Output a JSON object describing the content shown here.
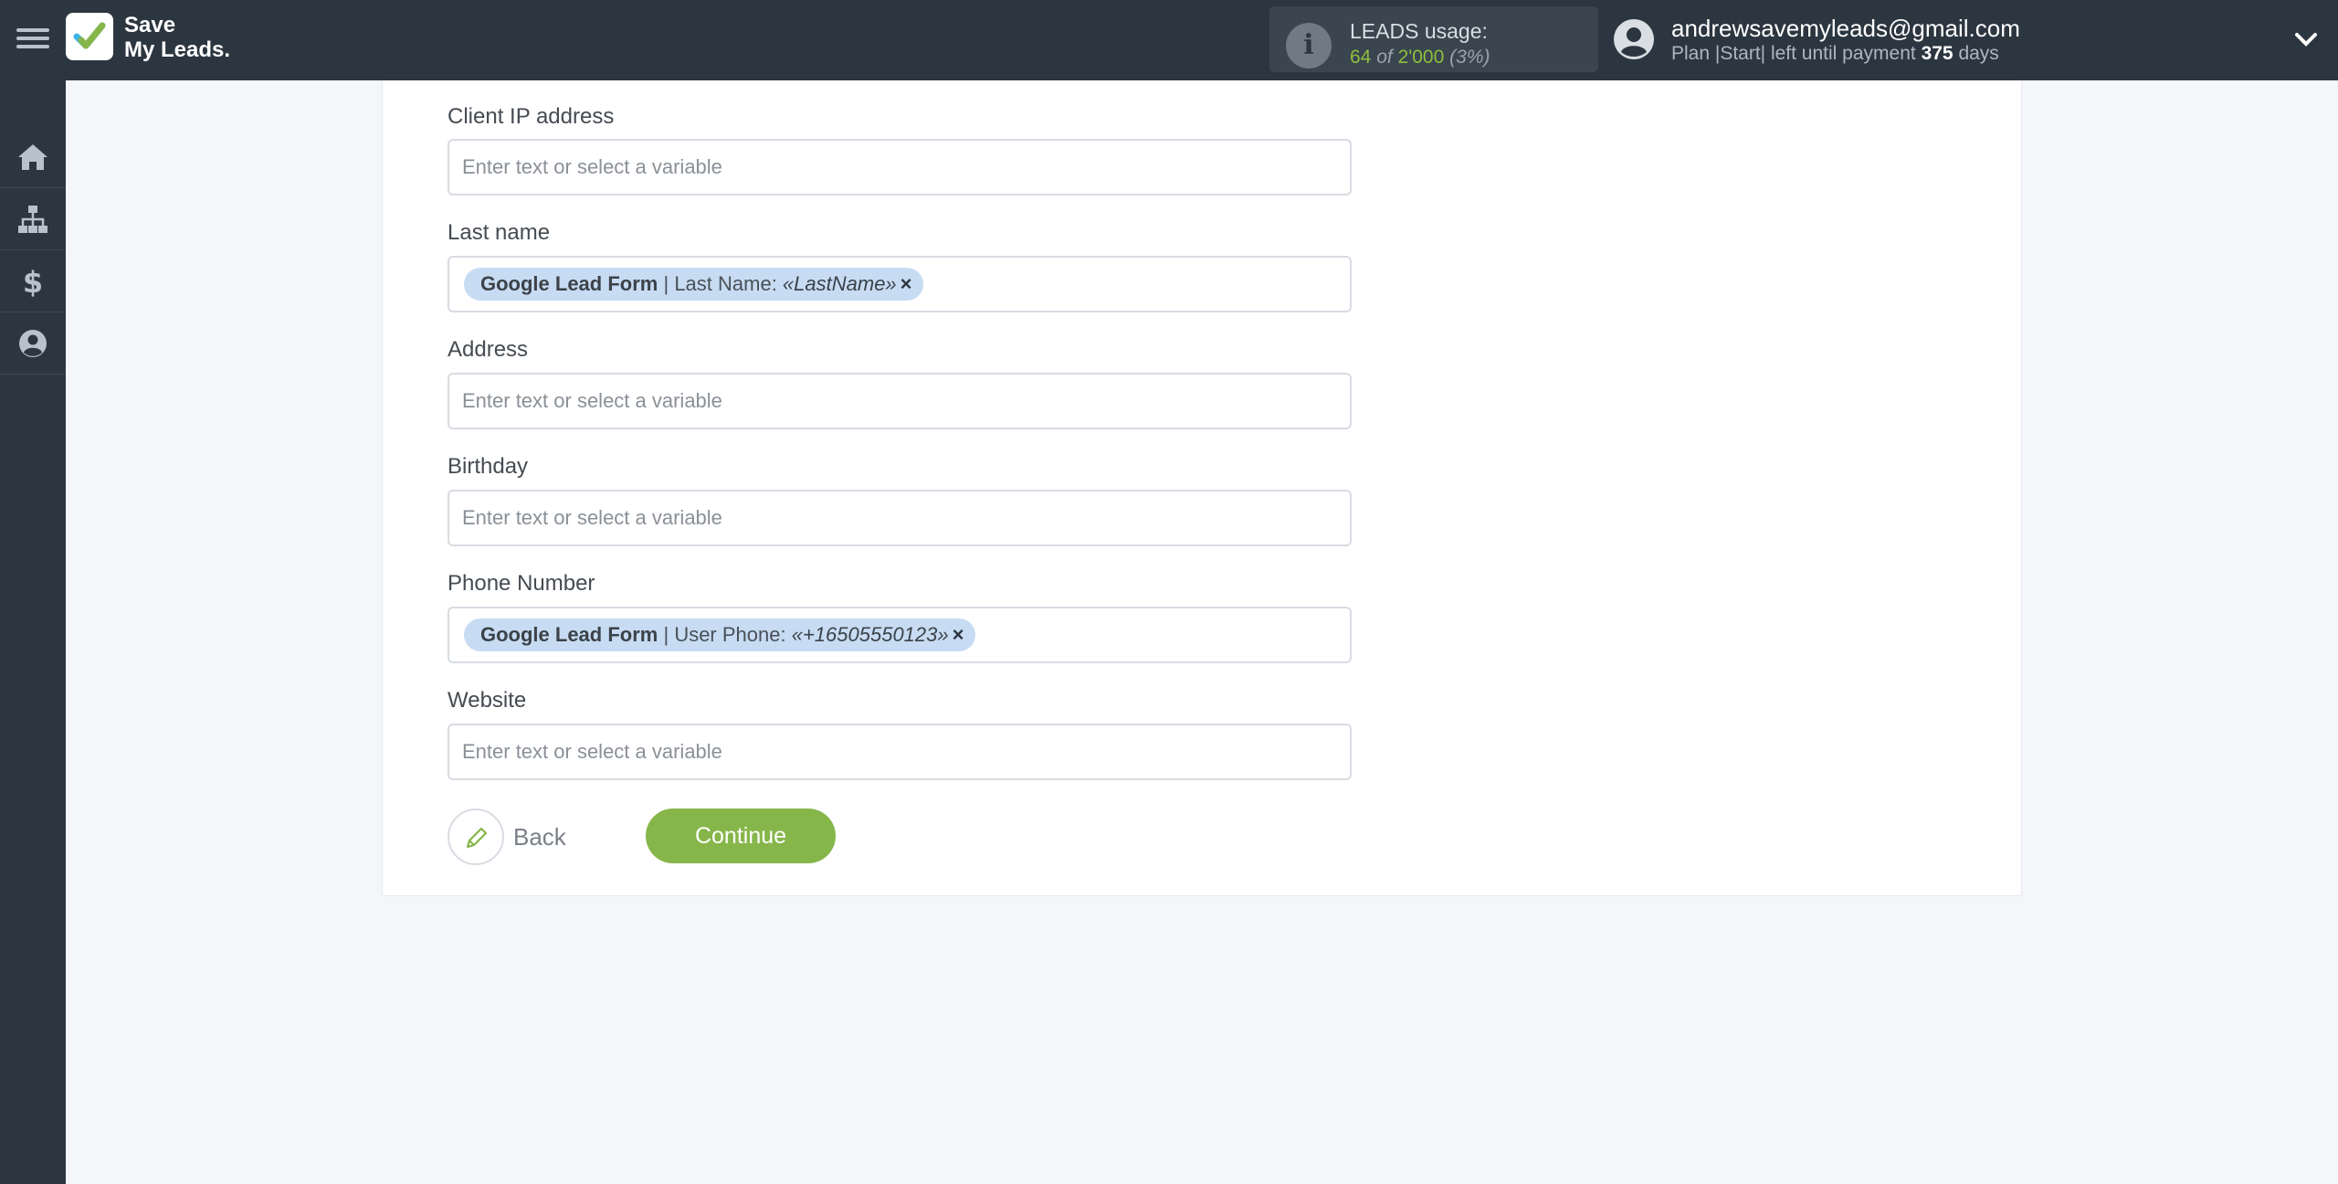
{
  "brand": {
    "line1": "Save",
    "line2": "My Leads."
  },
  "usage": {
    "title": "LEADS usage:",
    "used": "64",
    "of": "of",
    "total": "2'000",
    "percent": "(3%)"
  },
  "account": {
    "email": "andrewsavemyleads@gmail.com",
    "plan_prefix": "Plan |Start| left until payment",
    "days": "375",
    "days_suffix": "days"
  },
  "sidebar": {
    "items": [
      "home-icon",
      "sitemap-icon",
      "dollar-icon",
      "user-icon"
    ]
  },
  "form": {
    "fields": [
      {
        "label": "Client IP address",
        "placeholder": "Enter text or select a variable"
      },
      {
        "label": "Last name",
        "chip": {
          "source": "Google Lead Form",
          "sep": " | ",
          "field": "Last Name: ",
          "value": "«LastName»",
          "remove": "×"
        }
      },
      {
        "label": "Address",
        "placeholder": "Enter text or select a variable"
      },
      {
        "label": "Birthday",
        "placeholder": "Enter text or select a variable"
      },
      {
        "label": "Phone Number",
        "chip": {
          "source": "Google Lead Form",
          "sep": " | ",
          "field": "User Phone: ",
          "value": "«+16505550123»",
          "remove": "×"
        }
      },
      {
        "label": "Website",
        "placeholder": "Enter text or select a variable"
      }
    ]
  },
  "actions": {
    "back": "Back",
    "continue": "Continue"
  },
  "colors": {
    "topbar": "#2c3640",
    "accent_green": "#86b64a",
    "chip_bg": "#c7dcf3"
  }
}
